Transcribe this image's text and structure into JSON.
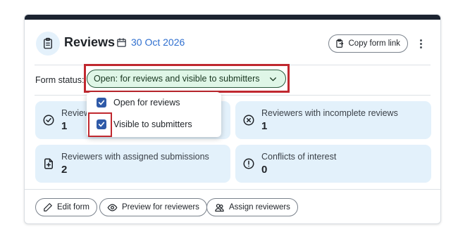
{
  "card": {
    "title": "Reviews",
    "date": "30 Oct 2026",
    "copy_link_label": "Copy form link"
  },
  "status": {
    "label": "Form status:",
    "value": "Open: for reviews and visible to submitters",
    "pill_bg": "#dff6e7",
    "highlight_color": "#c0282f"
  },
  "dropdown": {
    "options": [
      {
        "label": "Open for reviews",
        "checked": true
      },
      {
        "label": "Visible to submitters",
        "checked": true
      }
    ]
  },
  "tiles": [
    {
      "label": "Reviewers",
      "value": "1",
      "icon": "check-circle-icon"
    },
    {
      "label": "Reviewers with incomplete reviews",
      "value": "1",
      "icon": "x-circle-icon"
    },
    {
      "label": "Reviewers with assigned submissions",
      "value": "2",
      "icon": "file-plus-icon"
    },
    {
      "label": "Conflicts of interest",
      "value": "0",
      "icon": "alert-circle-icon"
    }
  ],
  "footer": {
    "edit_label": "Edit form",
    "preview_label": "Preview for reviewers",
    "assign_label": "Assign reviewers"
  },
  "colors": {
    "accent": "#2f6fcf",
    "tile_bg": "#e3f1fb",
    "checkbox": "#2f5aa8",
    "topbar": "#1b2330"
  }
}
